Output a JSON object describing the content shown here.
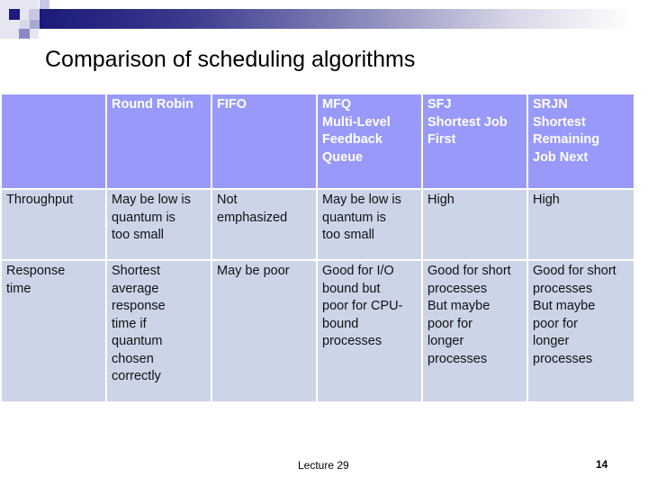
{
  "slide": {
    "title": "Comparison of scheduling algorithms",
    "footer": "Lecture 29",
    "page_number": "14"
  },
  "colors": {
    "header_bg": "#9999fa",
    "body_bg": "#ccd5e8",
    "accent_dark": "#1a1a7a"
  },
  "table": {
    "corner": "",
    "columns": [
      "Round Robin",
      "FIFO",
      "MFQ\nMulti-Level\nFeedback\nQueue",
      "SFJ\nShortest Job\nFirst",
      "SRJN\nShortest\nRemaining\nJob Next"
    ],
    "rows": [
      {
        "label": "Throughput",
        "cells": [
          "May be low is\nquantum is\ntoo small",
          "Not\nemphasized",
          "May be low is\nquantum is\ntoo small",
          "High",
          "High"
        ]
      },
      {
        "label": "Response\ntime",
        "cells": [
          "Shortest\naverage\nresponse\ntime if\nquantum\nchosen\ncorrectly",
          "May be poor",
          "Good for I/O\nbound but\npoor for CPU-\nbound\nprocesses",
          "Good for short\nprocesses\nBut maybe\npoor for\nlonger\nprocesses",
          "Good for short\nprocesses\nBut maybe\npoor for\nlonger\nprocesses"
        ]
      }
    ]
  }
}
